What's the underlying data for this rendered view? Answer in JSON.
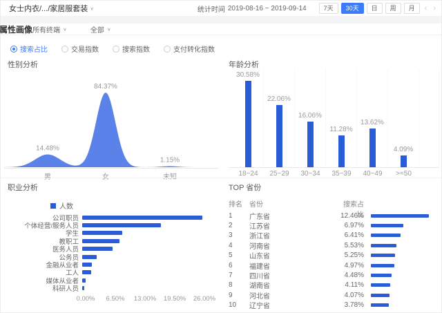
{
  "icons": {
    "chevron_down": "∨",
    "prev": "‹",
    "next": "›"
  },
  "colors": {
    "accent": "#3b7cf8",
    "density_fill": "#5b82e8",
    "bar_blue": "#2a5cd8"
  },
  "header": {
    "breadcrumb": "女士内衣/.../家居服套装",
    "stat_time_label": "统计时间",
    "stat_time_range": "2019-08-16 ~ 2019-09-14",
    "range_buttons": [
      "7天",
      "30天",
      "日",
      "周",
      "月"
    ],
    "active_range": "30天"
  },
  "toolbar": {
    "section_title": "属性画像",
    "terminal_filter": "所有终端",
    "scope_filter": "全部"
  },
  "metrics": {
    "options": [
      "搜索占比",
      "交易指数",
      "搜索指数",
      "支付转化指数"
    ],
    "selected": "搜索占比"
  },
  "chart_data": [
    {
      "type": "area",
      "title": "性别分析",
      "categories": [
        "男",
        "女",
        "未知"
      ],
      "values": [
        14.48,
        84.37,
        1.15
      ],
      "unit": "%",
      "ylim": [
        0,
        90
      ],
      "grid": false
    },
    {
      "type": "bar",
      "title": "年龄分析",
      "categories": [
        "18~24",
        "25~29",
        "30~34",
        "35~39",
        "40~49",
        ">=50"
      ],
      "values": [
        30.58,
        22.06,
        16.06,
        11.28,
        13.62,
        4.09
      ],
      "unit": "%",
      "ylim": [
        0,
        32
      ],
      "grid": false
    },
    {
      "type": "bar",
      "orientation": "horizontal",
      "title": "职业分析",
      "legend": [
        "人数"
      ],
      "legend_position": "top",
      "categories": [
        "公司职员",
        "个体经营/服务人员",
        "学生",
        "教职工",
        "医务人员",
        "公务员",
        "金融从业者",
        "工人",
        "媒体从业者",
        "科研人员"
      ],
      "values": [
        26.3,
        17.2,
        8.7,
        8.1,
        6.7,
        3.1,
        2.1,
        2.0,
        0.8,
        0.4
      ],
      "unit": "%",
      "xticks": [
        "0.00%",
        "6.50%",
        "13.00%",
        "19.50%",
        "26.00%"
      ],
      "xlim": [
        0,
        26
      ]
    },
    {
      "type": "table",
      "title": "TOP 省份",
      "columns": [
        "排名",
        "省份",
        "搜索占比"
      ],
      "rows": [
        [
          "1",
          "广东省",
          "12.46%"
        ],
        [
          "2",
          "江苏省",
          "6.97%"
        ],
        [
          "3",
          "浙江省",
          "6.41%"
        ],
        [
          "4",
          "河南省",
          "5.53%"
        ],
        [
          "5",
          "山东省",
          "5.25%"
        ],
        [
          "6",
          "福建省",
          "4.97%"
        ],
        [
          "7",
          "四川省",
          "4.48%"
        ],
        [
          "8",
          "湖南省",
          "4.11%"
        ],
        [
          "9",
          "河北省",
          "4.07%"
        ],
        [
          "10",
          "辽宁省",
          "3.78%"
        ]
      ],
      "bar_max_value": 12.46
    }
  ]
}
